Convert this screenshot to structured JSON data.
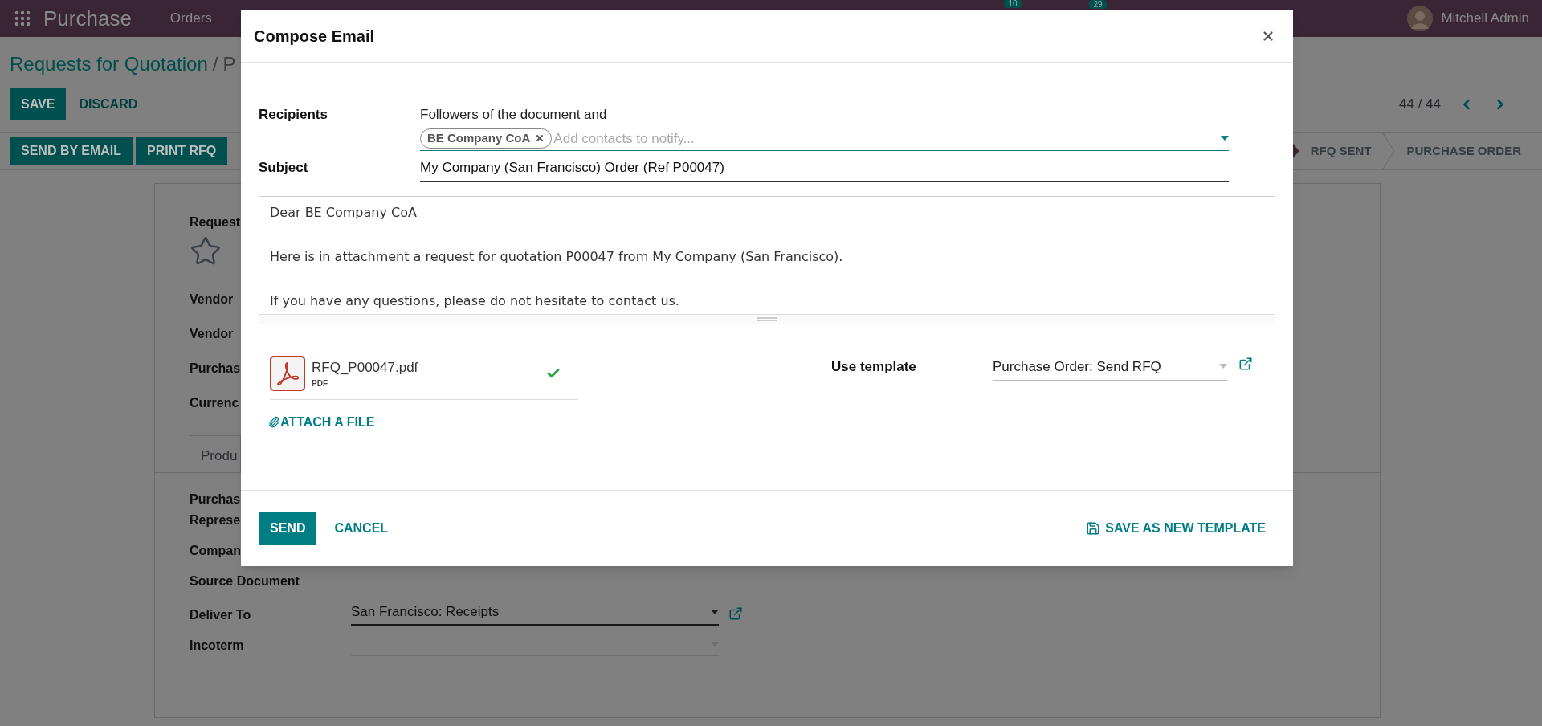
{
  "navbar": {
    "app_name": "Purchase",
    "menu": [
      "Orders"
    ],
    "messages_badge": "10",
    "calls_badge": "29",
    "user": "Mitchell Admin"
  },
  "breadcrumb": {
    "parent": "Requests for Quotation",
    "separator": "/",
    "current": "P"
  },
  "form_buttons": [
    {
      "label": "SAVE",
      "kind": "primary"
    },
    {
      "label": "DISCARD",
      "kind": "link"
    }
  ],
  "pager": "44 / 44",
  "action_buttons": [
    "SEND BY EMAIL",
    "PRINT RFQ"
  ],
  "stages": [
    {
      "label": "RFQ SENT",
      "selected": false
    },
    {
      "label": "PURCHASE ORDER",
      "selected": false
    }
  ],
  "sheet": {
    "title_label": "Request",
    "favorite": false,
    "fields": [
      "Vendor",
      "Vendor",
      "Purchas",
      "Currenc"
    ],
    "tab": "Produ",
    "other_fields": [
      {
        "lines": [
          "Purchas",
          "Represe"
        ]
      },
      {
        "lines": [
          "Compan"
        ]
      },
      {
        "lines": [
          "Source Document"
        ]
      },
      {
        "lines": [
          "Deliver To"
        ],
        "value": "San Francisco: Receipts",
        "kind": "select"
      },
      {
        "lines": [
          "Incoterm"
        ],
        "kind": "empty_select"
      }
    ]
  },
  "dialog": {
    "title": "Compose Email",
    "recipients_label": "Recipients",
    "followers_text": "Followers of the document and",
    "tags": [
      {
        "label": "BE Company CoA"
      }
    ],
    "contacts_placeholder": "Add contacts to notify...",
    "subject_label": "Subject",
    "subject_value": "My Company (San Francisco) Order (Ref P00047)",
    "body": [
      "Dear BE Company CoA",
      "Here is in attachment a request for quotation P00047 from My Company (San Francisco).",
      "If you have any questions, please do not hesitate to contact us."
    ],
    "attachments": [
      {
        "name": "RFQ_P00047.pdf",
        "type": "PDF",
        "uploaded": true
      }
    ],
    "attach_label": "ATTACH A FILE",
    "template_label": "Use template",
    "template_value": "Purchase Order: Send RFQ",
    "send": "SEND",
    "cancel": "CANCEL",
    "save_template": "SAVE AS NEW TEMPLATE"
  }
}
